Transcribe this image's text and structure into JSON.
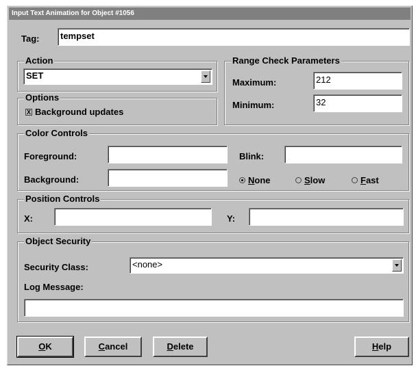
{
  "window": {
    "title": "Input Text Animation for Object #1056"
  },
  "tag": {
    "label": "Tag:",
    "value": "tempset"
  },
  "action": {
    "group_title": "Action",
    "selected": "SET",
    "icon": "chevron-down-icon"
  },
  "options": {
    "group_title": "Options",
    "background_updates": {
      "mark": "X",
      "label": "Background updates",
      "checked": true
    }
  },
  "range_check": {
    "group_title": "Range Check Parameters",
    "maximum_label": "Maximum:",
    "maximum_value": "212",
    "minimum_label": "Minimum:",
    "minimum_value": "32"
  },
  "color_controls": {
    "group_title": "Color Controls",
    "foreground_label": "Foreground:",
    "foreground_value": "",
    "background_label": "Background:",
    "background_value": "",
    "blink_label": "Blink:",
    "blink_value": "",
    "blink_rate": {
      "options": [
        {
          "pre": "",
          "key": "N",
          "rest": "one",
          "selected": true
        },
        {
          "pre": "",
          "key": "S",
          "rest": "low",
          "selected": false
        },
        {
          "pre": "",
          "key": "F",
          "rest": "ast",
          "selected": false
        }
      ]
    }
  },
  "position_controls": {
    "group_title": "Position Controls",
    "x_label": "X:",
    "x_value": "",
    "y_label": "Y:",
    "y_value": ""
  },
  "object_security": {
    "group_title": "Object Security",
    "security_class_label": "Security Class:",
    "security_class_selected": "<none>",
    "log_message_label": "Log Message:",
    "log_message_value": ""
  },
  "buttons": {
    "ok": {
      "key": "O",
      "rest": "K"
    },
    "cancel": {
      "key": "C",
      "rest": "ancel"
    },
    "delete": {
      "key": "D",
      "rest": "elete"
    },
    "help": {
      "key": "H",
      "rest": "elp"
    }
  },
  "colors": {
    "dialog_bg": "#c0c0c0",
    "titlebar_bg": "#808080",
    "field_bg": "#ffffff"
  }
}
